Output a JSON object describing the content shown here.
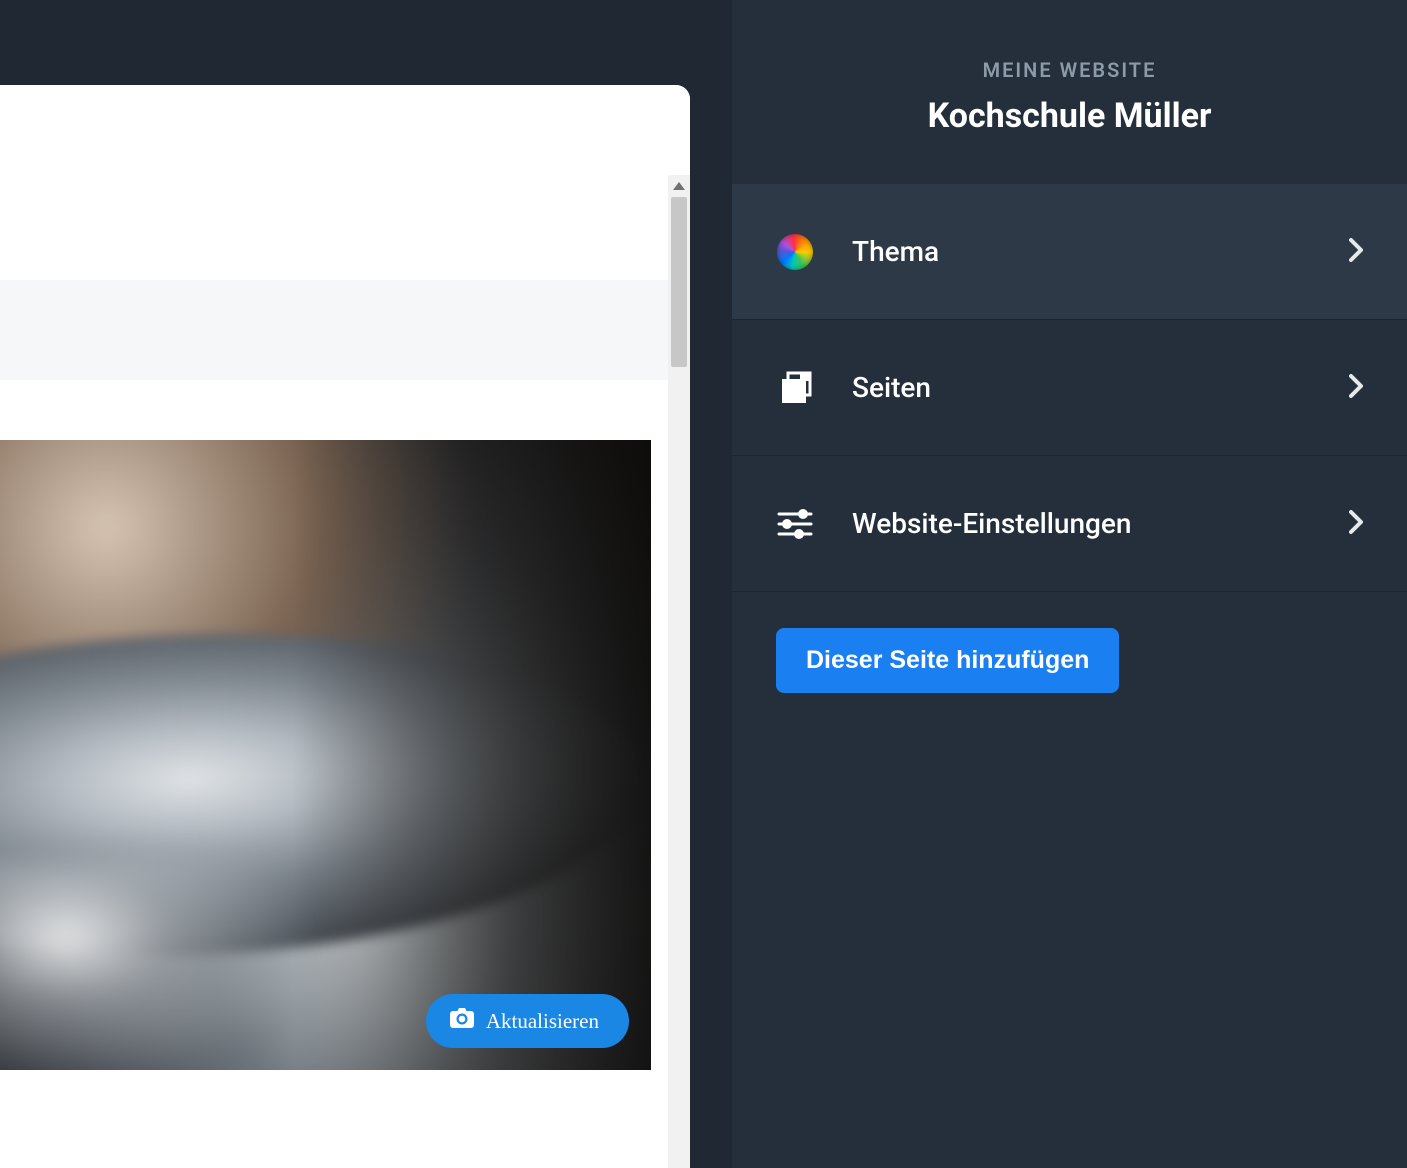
{
  "sidebar": {
    "eyebrow": "MEINE WEBSITE",
    "title": "Kochschule Müller",
    "items": [
      {
        "icon": "theme-color-wheel-icon",
        "label": "Thema"
      },
      {
        "icon": "pages-stack-icon",
        "label": "Seiten"
      },
      {
        "icon": "sliders-icon",
        "label": "Website-Einstellungen"
      }
    ],
    "add_button": "Dieser Seite hinzufügen"
  },
  "preview": {
    "refresh_button": "Aktualisieren"
  },
  "colors": {
    "accent": "#1a7ff0",
    "sidebar_bg": "#242f3b",
    "sidebar_item_hover": "#2e3947",
    "page_bg": "#1f2833"
  }
}
